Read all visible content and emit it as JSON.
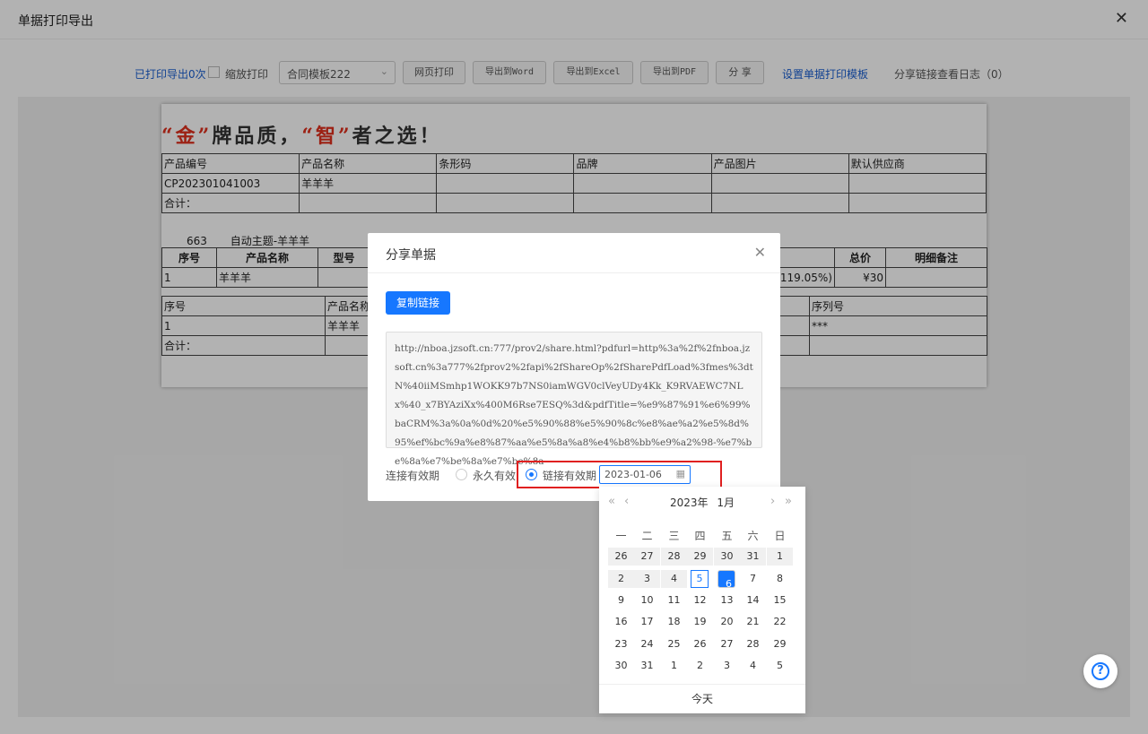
{
  "dialog": {
    "title": "单据打印导出",
    "close": "✕"
  },
  "toolbar": {
    "print_count": "已打印导出0次",
    "zoom_print": "缩放打印",
    "template": "合同模板222",
    "web_print": "网页打印",
    "to_word": "导出到Word",
    "to_excel": "导出到Excel",
    "to_pdf": "导出到PDF",
    "share": "分 享",
    "set_template": "设置单据打印模板",
    "share_log": "分享链接查看日志（0）"
  },
  "document": {
    "slogan": {
      "p1": "“金”",
      "p2": "牌品质，",
      "p3": "“智”",
      "p4": "者之选！"
    },
    "t1": {
      "headers": [
        "产品编号",
        "产品名称",
        "条形码",
        "品牌",
        "产品图片",
        "默认供应商"
      ],
      "row": [
        "CP202301041003",
        "羊羊羊",
        "",
        "",
        "",
        ""
      ],
      "total": "合计："
    },
    "group": {
      "num": "663",
      "name": "自动主题-羊羊羊"
    },
    "t2": {
      "headers": [
        "序号",
        "产品名称",
        "型号",
        "总价",
        "明细备注"
      ],
      "row": {
        "no": "1",
        "name": "羊羊羊",
        "pct": "(119.05%)",
        "total": "¥30"
      }
    },
    "t3": {
      "headers": [
        "序号",
        "产品名称",
        "序列号"
      ],
      "row": {
        "no": "1",
        "name": "羊羊羊",
        "serial": "***"
      },
      "total": "合计："
    }
  },
  "share_modal": {
    "title": "分享单据",
    "close": "✕",
    "copy_button": "复制链接",
    "url": "http://nboa.jzsoft.cn:777/prov2/share.html?pdfurl=http%3a%2f%2fnboa.jzsoft.cn%3a777%2fprov2%2fapi%2fShareOp%2fSharePdfLoad%3fmes%3dtN%40iiMSmhp1WOKK97b7NS0iamWGV0clVeyUDy4Kk_K9RVAEWC7NLx%40_x7BYAziXx%400M6Rse7ESQ%3d&pdfTitle=%e9%87%91%e6%99%baCRM%3a%0a%0d%20%e5%90%88%e5%90%8c%e8%ae%a2%e5%8d%95%ef%bc%9a%e8%87%aa%e5%8a%a8%e4%b8%bb%e9%a2%98-%e7%be%8a%e7%be%8a%e7%be%8a",
    "validity_label": "连接有效期",
    "opt_forever": "永久有效",
    "opt_period": "链接有效期",
    "date_value": "2023-01-06",
    "selected_option": "opt_period"
  },
  "calendar": {
    "year_label": "2023年",
    "month_label": "1月",
    "weekdays": [
      "一",
      "二",
      "三",
      "四",
      "五",
      "六",
      "日"
    ],
    "rows": [
      [
        "26",
        "27",
        "28",
        "29",
        "30",
        "31",
        "1"
      ],
      [
        "2",
        "3",
        "4",
        "5",
        "6",
        "7",
        "8"
      ],
      [
        "9",
        "10",
        "11",
        "12",
        "13",
        "14",
        "15"
      ],
      [
        "16",
        "17",
        "18",
        "19",
        "20",
        "21",
        "22"
      ],
      [
        "23",
        "24",
        "25",
        "26",
        "27",
        "28",
        "29"
      ],
      [
        "30",
        "31",
        "1",
        "2",
        "3",
        "4",
        "5"
      ]
    ],
    "today": "5",
    "selected": "6",
    "today_button": "今天"
  },
  "help": {
    "icon": "question-icon",
    "glyph": "?"
  },
  "colors": {
    "primary": "#1677ff",
    "link": "#1a5fd1",
    "highlight": "#e02020",
    "slogan_red": "#e0301e"
  }
}
